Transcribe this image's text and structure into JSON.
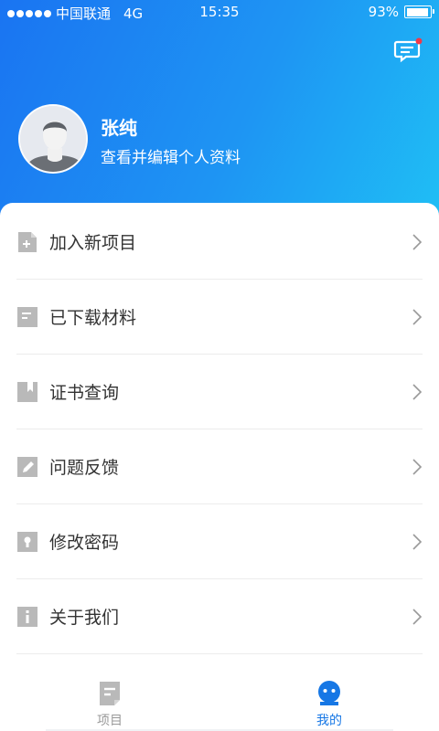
{
  "status_bar": {
    "carrier": "中国联通",
    "network": "4G",
    "time": "15:35",
    "battery": "93%",
    "battery_level": 0.93
  },
  "profile": {
    "name": "张纯",
    "subtitle": "查看并编辑个人资料"
  },
  "menu": [
    {
      "label": "加入新项目",
      "icon": "file-add-icon"
    },
    {
      "label": "已下载材料",
      "icon": "document-icon"
    },
    {
      "label": "证书查询",
      "icon": "certificate-bookmark-icon"
    },
    {
      "label": "问题反馈",
      "icon": "edit-pencil-icon"
    },
    {
      "label": "修改密码",
      "icon": "lock-icon"
    },
    {
      "label": "关于我们",
      "icon": "info-icon"
    }
  ],
  "tabs": [
    {
      "label": "项目",
      "icon": "project-document-icon",
      "active": false
    },
    {
      "label": "我的",
      "icon": "profile-face-icon",
      "active": true
    }
  ],
  "colors": {
    "header_gradient_start": "#1a74f2",
    "header_gradient_end": "#1fc0f5",
    "accent": "#1677e5",
    "icon_gray": "#b9b9b9",
    "tab_inactive": "#999999",
    "notification_dot": "#f0394a"
  }
}
